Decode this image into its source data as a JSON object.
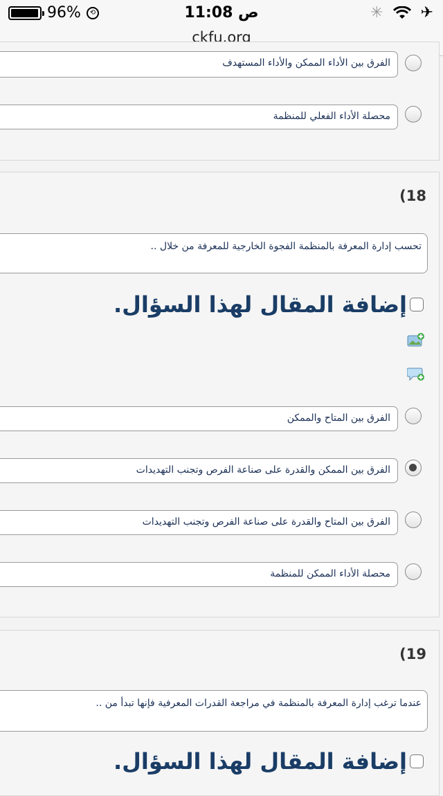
{
  "status": {
    "battery": "96%",
    "time": "11:08 ص",
    "url": "ckfu.org"
  },
  "prev_question": {
    "options": [
      {
        "label": "الفرق بين الأداء الممكن والأداء المستهدف",
        "checked": false
      },
      {
        "label": "محصلة الأداء الفعلي للمنظمة",
        "checked": false
      }
    ]
  },
  "q18": {
    "number": "(18",
    "text": "تحسب إدارة المعرفة بالمنظمة الفجوة الخارجية للمعرفة من خلال ..",
    "essay_label": "إضافة المقال لهذا السؤال.",
    "options": [
      {
        "label": "الفرق بين المتاح والممكن",
        "checked": false
      },
      {
        "label": "الفرق بين الممكن والقدرة على صناعة الفرص وتجنب التهديدات",
        "checked": true
      },
      {
        "label": "الفرق بين المتاح والقدرة على صناعة الفرص وتجنب التهديدات",
        "checked": false
      },
      {
        "label": "محصلة الأداء الممكن للمنظمة",
        "checked": false
      }
    ]
  },
  "q19": {
    "number": "(19",
    "text": "عندما ترغب إدارة المعرفة بالمنظمة في مراجعة القدرات المعرفية فإنها تبدأ من ..",
    "essay_label": "إضافة المقال لهذا السؤال."
  }
}
